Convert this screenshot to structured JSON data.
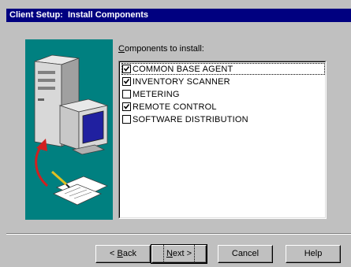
{
  "window": {
    "title": "Client Setup:  Install Components"
  },
  "components": {
    "label": "Components to install:",
    "label_accel": "C",
    "label_rest": "omponents to install:",
    "items": [
      {
        "label": "COMMON BASE AGENT",
        "checked": true
      },
      {
        "label": "INVENTORY SCANNER",
        "checked": true
      },
      {
        "label": "METERING",
        "checked": false
      },
      {
        "label": "REMOTE CONTROL",
        "checked": true
      },
      {
        "label": "SOFTWARE DISTRIBUTION",
        "checked": false
      }
    ]
  },
  "buttons": {
    "back": {
      "prefix": "< ",
      "accel": "B",
      "rest": "ack"
    },
    "next": {
      "accel": "N",
      "rest": "ext >"
    },
    "cancel": {
      "label": "Cancel"
    },
    "help": {
      "label": "Help"
    }
  },
  "colors": {
    "titlebar": "#000080",
    "illustration_bg": "#008080",
    "face": "#c0c0c0"
  },
  "icons": [
    "computer-tower-icon",
    "monitor-icon",
    "curved-arrow-icon",
    "documents-pen-icon",
    "checkmark-icon"
  ]
}
